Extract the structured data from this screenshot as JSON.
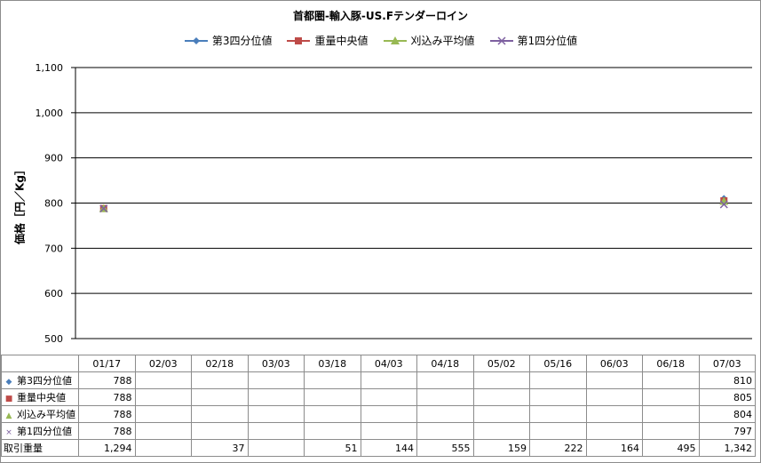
{
  "chart_data": {
    "type": "scatter",
    "title": "首都圏-輸入豚-US.Fテンダーロイン",
    "ylabel": "価格［円／Kg］",
    "xlabel": "",
    "ylim": [
      500,
      1100
    ],
    "yticks": [
      "500",
      "600",
      "700",
      "800",
      "900",
      "1,000",
      "1,100"
    ],
    "ytick_values": [
      500,
      600,
      700,
      800,
      900,
      1000,
      1100
    ],
    "categories": [
      "01/17",
      "02/03",
      "02/18",
      "03/03",
      "03/18",
      "04/03",
      "04/18",
      "05/02",
      "05/16",
      "06/03",
      "06/18",
      "07/03"
    ],
    "grid": true,
    "legend_position": "top",
    "series": [
      {
        "name": "第3四分位値",
        "values": [
          788,
          null,
          null,
          null,
          null,
          null,
          null,
          null,
          null,
          null,
          null,
          810
        ],
        "color": "#4a7ebb",
        "marker": "diamond"
      },
      {
        "name": "重量中央値",
        "values": [
          788,
          null,
          null,
          null,
          null,
          null,
          null,
          null,
          null,
          null,
          null,
          805
        ],
        "color": "#be4b48",
        "marker": "square"
      },
      {
        "name": "刈込み平均値",
        "values": [
          788,
          null,
          null,
          null,
          null,
          null,
          null,
          null,
          null,
          null,
          null,
          804
        ],
        "color": "#98b954",
        "marker": "triangle"
      },
      {
        "name": "第1四分位値",
        "values": [
          788,
          null,
          null,
          null,
          null,
          null,
          null,
          null,
          null,
          null,
          null,
          797
        ],
        "color": "#7d60a0",
        "marker": "x"
      }
    ],
    "table_rows": [
      {
        "label": "第3四分位値",
        "marker": "◆",
        "color": "#4a7ebb",
        "cells": [
          "788",
          "",
          "",
          "",
          "",
          "",
          "",
          "",
          "",
          "",
          "",
          "810"
        ]
      },
      {
        "label": "重量中央値",
        "marker": "■",
        "color": "#be4b48",
        "cells": [
          "788",
          "",
          "",
          "",
          "",
          "",
          "",
          "",
          "",
          "",
          "",
          "805"
        ]
      },
      {
        "label": "刈込み平均値",
        "marker": "▲",
        "color": "#98b954",
        "cells": [
          "788",
          "",
          "",
          "",
          "",
          "",
          "",
          "",
          "",
          "",
          "",
          "804"
        ]
      },
      {
        "label": "第1四分位値",
        "marker": "×",
        "color": "#7d60a0",
        "cells": [
          "788",
          "",
          "",
          "",
          "",
          "",
          "",
          "",
          "",
          "",
          "",
          "797"
        ]
      },
      {
        "label": "取引重量",
        "marker": "",
        "color": "#000000",
        "cells": [
          "1,294",
          "",
          "37",
          "",
          "51",
          "144",
          "555",
          "159",
          "222",
          "164",
          "495",
          "1,342"
        ]
      }
    ]
  }
}
